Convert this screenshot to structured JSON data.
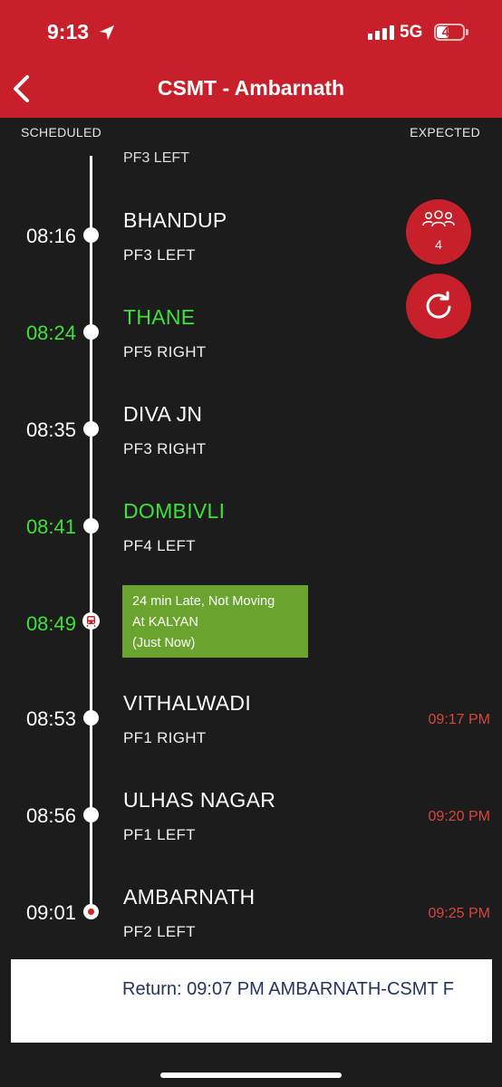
{
  "status_bar": {
    "time": "9:13",
    "network": "5G",
    "battery": "41"
  },
  "header": {
    "title": "CSMT - Ambarnath"
  },
  "columns": {
    "scheduled": "SCHEDULED",
    "expected": "EXPECTED"
  },
  "partial_platform": "PF3 LEFT",
  "stops": [
    {
      "scheduled": "08:16",
      "station": "BHANDUP",
      "platform": "PF3 LEFT",
      "expected": ""
    },
    {
      "scheduled": "08:24",
      "station": "THANE",
      "platform": "PF5 RIGHT",
      "expected": ""
    },
    {
      "scheduled": "08:35",
      "station": "DIVA JN",
      "platform": "PF3 RIGHT",
      "expected": ""
    },
    {
      "scheduled": "08:41",
      "station": "DOMBIVLI",
      "platform": "PF4 LEFT",
      "expected": ""
    },
    {
      "scheduled": "08:53",
      "station": "VITHALWADI",
      "platform": "PF1 RIGHT",
      "expected": "09:17 PM"
    },
    {
      "scheduled": "08:56",
      "station": "ULHAS NAGAR",
      "platform": "PF1 LEFT",
      "expected": "09:20 PM"
    },
    {
      "scheduled": "09:01",
      "station": "AMBARNATH",
      "platform": "PF2 LEFT",
      "expected": "09:25 PM"
    }
  ],
  "live_status": {
    "scheduled": "08:49",
    "line1": "24 min Late, Not Moving",
    "line2": "At KALYAN",
    "line3": "(Just Now)"
  },
  "crowd_button": {
    "count": "4",
    "icon": "people-icon"
  },
  "refresh_button": {
    "icon": "refresh-icon"
  },
  "return_bar": {
    "text": "Return: 09:07 PM AMBARNATH-CSMT F"
  },
  "colors": {
    "header": "#c8202a",
    "background": "#1c1c1c",
    "passed_station": "#3ee03a",
    "expected_time": "#d9463b",
    "live_status_bg": "#6aa42f",
    "return_text": "#23345f"
  }
}
